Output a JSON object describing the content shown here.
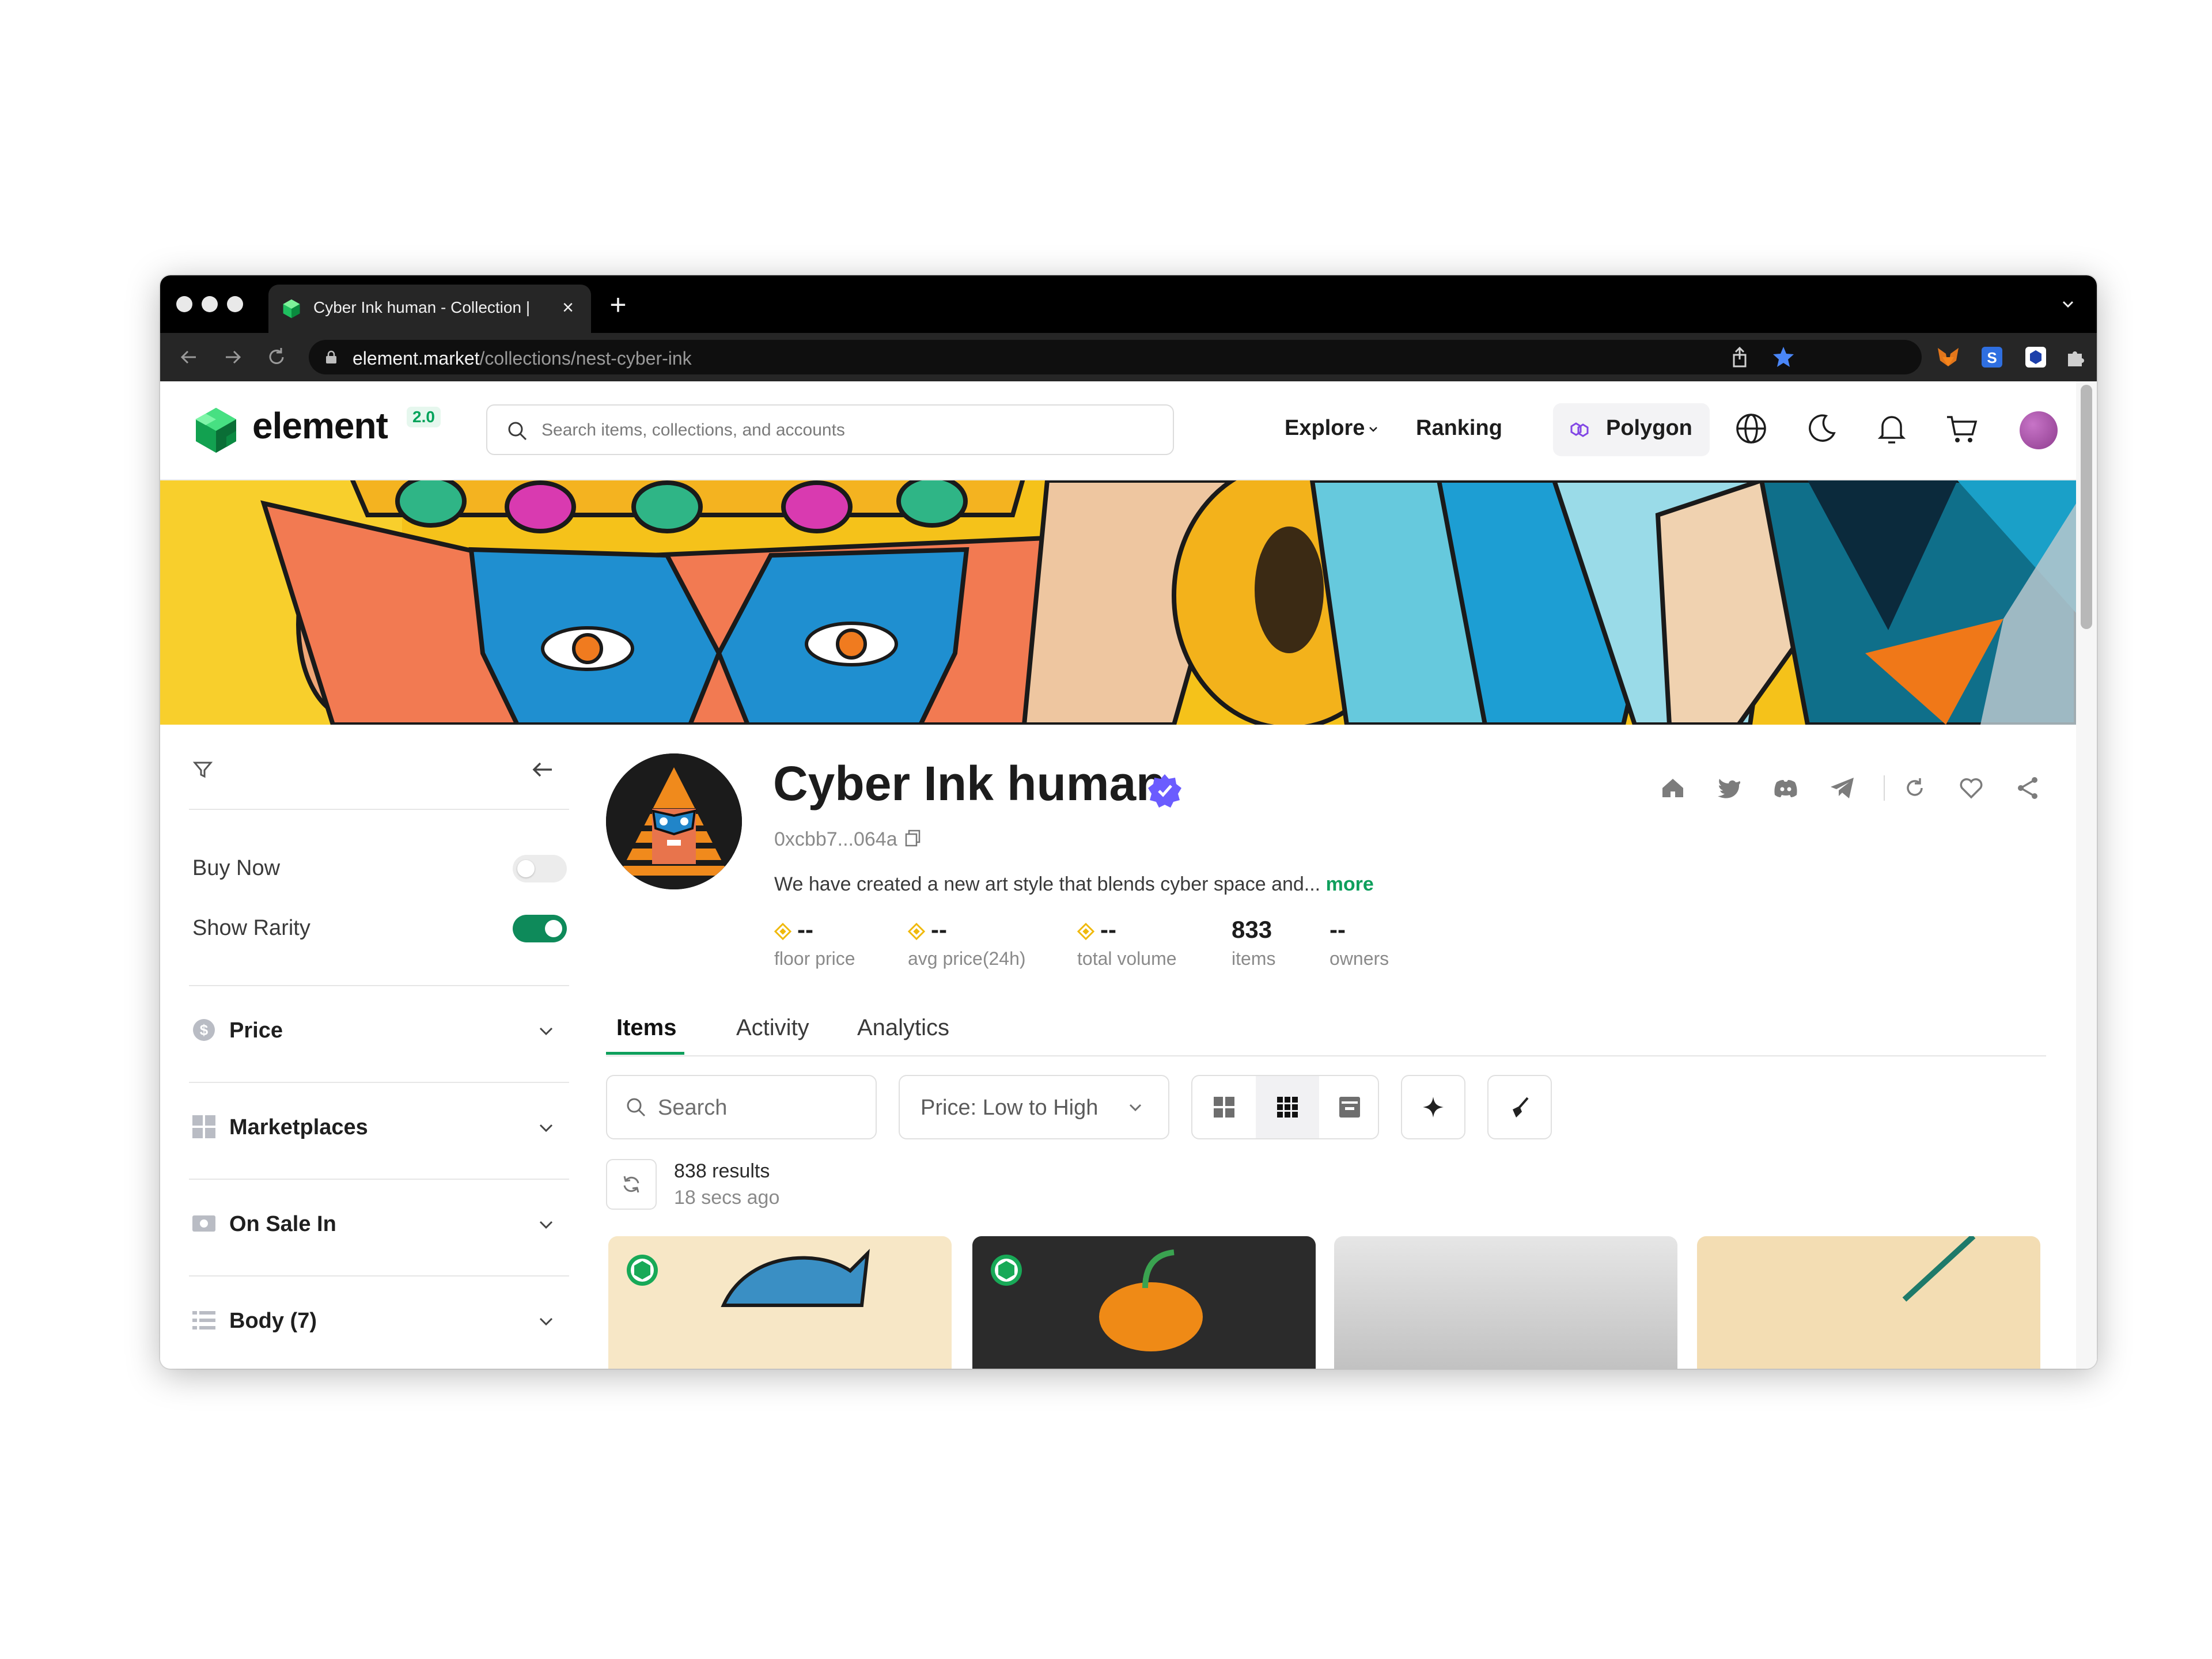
{
  "browser": {
    "tab_title": "Cyber Ink human - Collection |",
    "url_host": "element.market",
    "url_path": "/collections/nest-cyber-ink"
  },
  "header": {
    "logo": "element",
    "logo_badge": "2.0",
    "search_placeholder": "Search items, collections, and accounts",
    "nav": [
      "Explore",
      "Ranking"
    ],
    "network": "Polygon"
  },
  "sidebar": {
    "toggles": [
      {
        "label": "Buy Now",
        "on": false
      },
      {
        "label": "Show Rarity",
        "on": true
      }
    ],
    "sections": [
      "Price",
      "Marketplaces",
      "On Sale In",
      "Body (7)"
    ]
  },
  "collection": {
    "name": "Cyber Ink human",
    "address": "0xcbb7...064a",
    "description": "We have created a new art style that blends cyber space and...",
    "more_label": "more",
    "stats": [
      {
        "value": "--",
        "label": "floor price",
        "coin": true
      },
      {
        "value": "--",
        "label": "avg price(24h)",
        "coin": true
      },
      {
        "value": "--",
        "label": "total volume",
        "coin": true
      },
      {
        "value": "833",
        "label": "items",
        "coin": false
      },
      {
        "value": "--",
        "label": "owners",
        "coin": false
      }
    ]
  },
  "tabs": [
    "Items",
    "Activity",
    "Analytics"
  ],
  "toolbar": {
    "search_placeholder": "Search",
    "sort_value": "Price: Low to High"
  },
  "results": {
    "count_text": "838 results",
    "updated_text": "18 secs ago"
  },
  "colors": {
    "accent": "#0e9f5c",
    "verified": "#6b5cff",
    "coin": "#f0b90b"
  }
}
